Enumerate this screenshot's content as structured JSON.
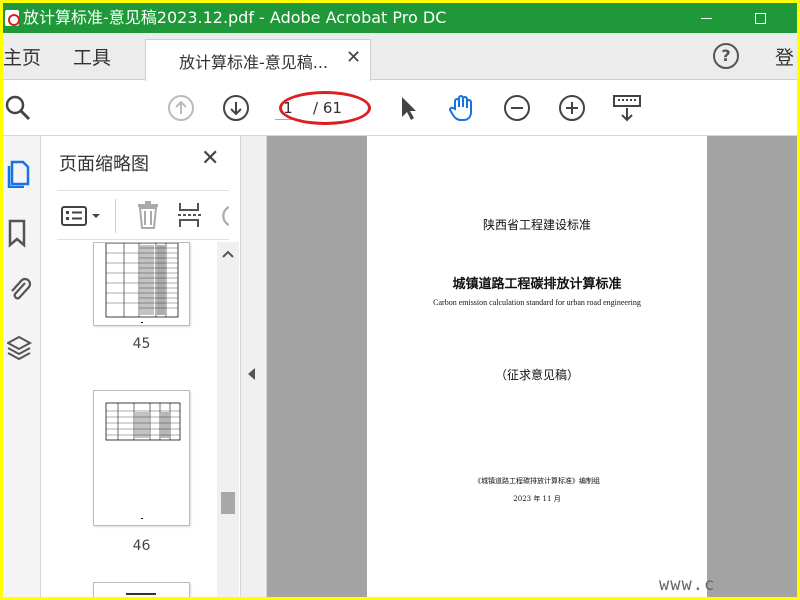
{
  "window": {
    "title": "放计算标准-意见稿2023.12.pdf - Adobe Acrobat Pro DC"
  },
  "tabs": {
    "home": "主页",
    "tools": "工具",
    "document": "放计算标准-意见稿...",
    "signin": "登"
  },
  "toolbar": {
    "current_page": "1",
    "total_pages": "/ 61"
  },
  "panel": {
    "title": "页面缩略图",
    "thumbnails": [
      {
        "label": "45"
      },
      {
        "label": "46"
      }
    ]
  },
  "document": {
    "standard_type": "陕西省工程建设标准",
    "title_cn": "城镇道路工程碳排放计算标准",
    "title_en": "Carbon emission calculation standard for urban road engineering",
    "draft": "（征求意见稿）",
    "editor": "《城镇道路工程碳排放计算标准》编制组",
    "date": "2023 年 11 月"
  },
  "watermark": "www.c",
  "colors": {
    "titlebar": "#1e9838",
    "frame": "#ffff00",
    "annotation": "#dc2020",
    "accent": "#1473e6"
  }
}
